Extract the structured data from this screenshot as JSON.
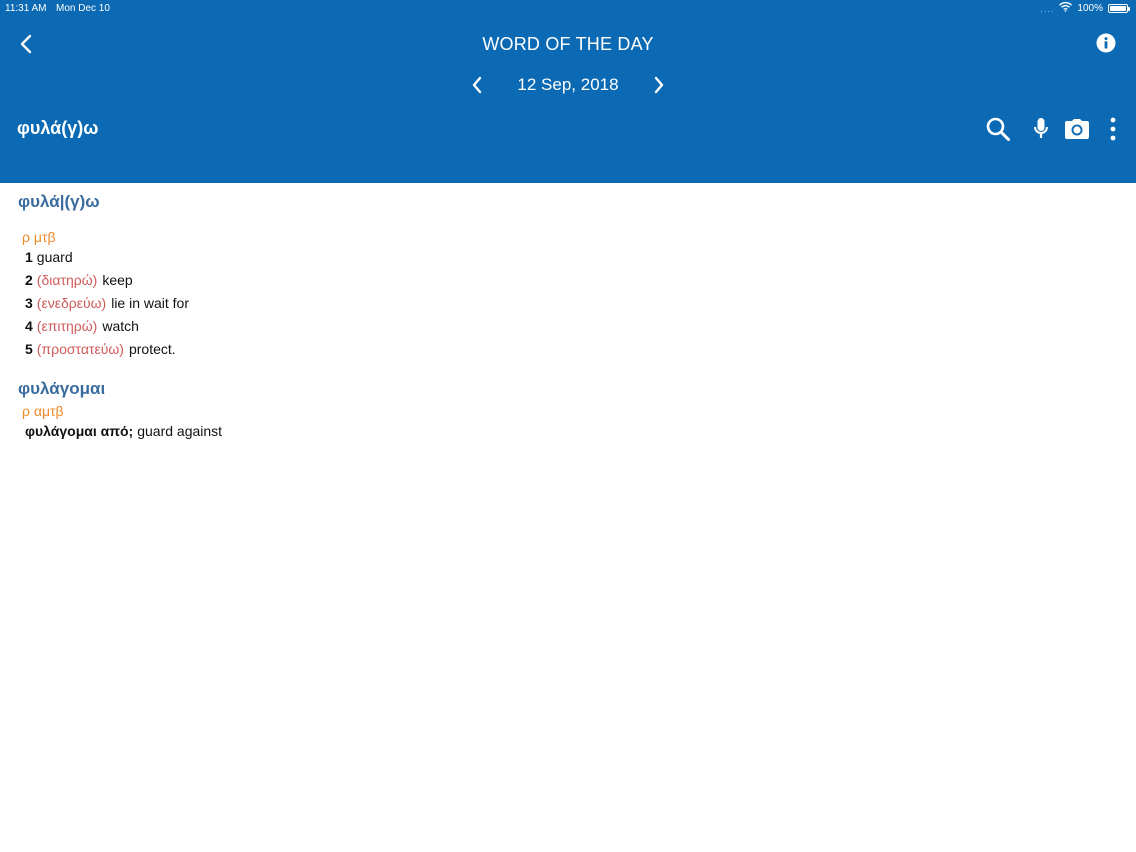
{
  "status": {
    "time": "11:31 AM",
    "date": "Mon Dec 10",
    "signal": "....",
    "battery": "100%"
  },
  "header": {
    "title": "WORD OF THE DAY",
    "date": "12 Sep, 2018",
    "search_word": "φυλά(γ)ω",
    "background_color": "#0b6ab3"
  },
  "icons": {
    "back": "chevron-left-icon",
    "info": "info-icon",
    "prev": "chevron-left-icon",
    "next": "chevron-right-icon",
    "search": "search-icon",
    "mic": "microphone-icon",
    "camera": "camera-icon",
    "more": "more-vertical-icon"
  },
  "entry": {
    "headword": "φυλά|(γ)ω",
    "pos": "ρ μτβ",
    "senses": [
      {
        "num": "1",
        "gloss": "",
        "translation": "guard"
      },
      {
        "num": "2",
        "gloss": "(διατηρώ)",
        "translation": "keep"
      },
      {
        "num": "3",
        "gloss": "(ενεδρεύω)",
        "translation": "lie in wait for"
      },
      {
        "num": "4",
        "gloss": "(επιτηρώ)",
        "translation": "watch"
      },
      {
        "num": "5",
        "gloss": "(προστατεύω)",
        "translation": "protect."
      }
    ],
    "subentry": {
      "headword": "φυλάγομαι",
      "pos": "ρ αμτβ",
      "phrase": "φυλάγομαι από;",
      "translation": "guard against"
    }
  },
  "colors": {
    "headword": "#3a6b9e",
    "pos": "#ef8a2a",
    "gloss": "#d05a5a"
  }
}
